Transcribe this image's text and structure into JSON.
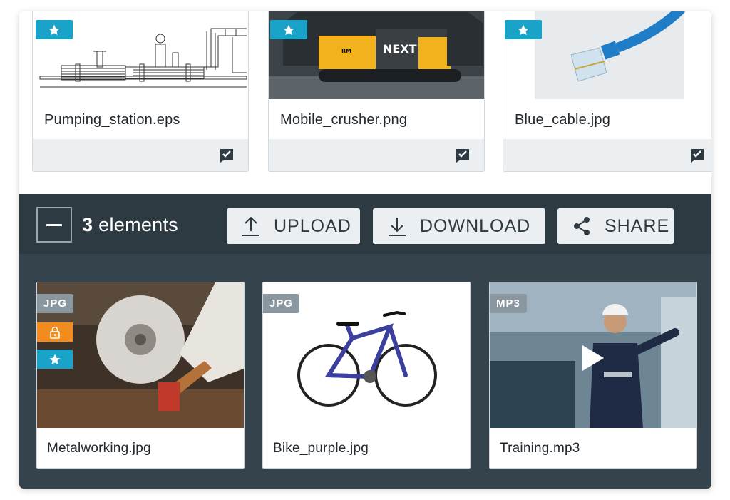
{
  "top_cards": [
    {
      "name": "Pumping_station.eps",
      "thumb_icon": "pipeline-drawing-image",
      "badge_icon": "star-icon",
      "status_icon": "check-comment-icon"
    },
    {
      "name": "Mobile_crusher.png",
      "thumb_icon": "crusher-machine-image",
      "badge_icon": "star-icon",
      "status_icon": "check-comment-icon"
    },
    {
      "name": "Blue_cable.jpg",
      "thumb_icon": "network-cable-image",
      "badge_icon": "star-icon",
      "status_icon": "check-comment-icon"
    }
  ],
  "selection_bar": {
    "count": "3",
    "count_label": "elements",
    "actions": [
      {
        "label": "UPLOAD",
        "icon": "upload-icon"
      },
      {
        "label": "DOWNLOAD",
        "icon": "download-icon"
      },
      {
        "label": "SHARE",
        "icon": "share-icon"
      }
    ]
  },
  "selected_cards": [
    {
      "name": "Metalworking.jpg",
      "type": "JPG",
      "locked": true,
      "starred": true
    },
    {
      "name": "Bike_purple.jpg",
      "type": "JPG",
      "locked": false,
      "starred": false
    },
    {
      "name": "Training.mp3",
      "type": "MP3",
      "locked": false,
      "starred": false,
      "playable": true
    }
  ],
  "colors": {
    "accent_blue": "#1aa3c8",
    "lock_orange": "#f28c1e",
    "bar_dark": "#2e3a42",
    "panel_dark": "#34434c",
    "badge_gray": "#8a979f"
  }
}
